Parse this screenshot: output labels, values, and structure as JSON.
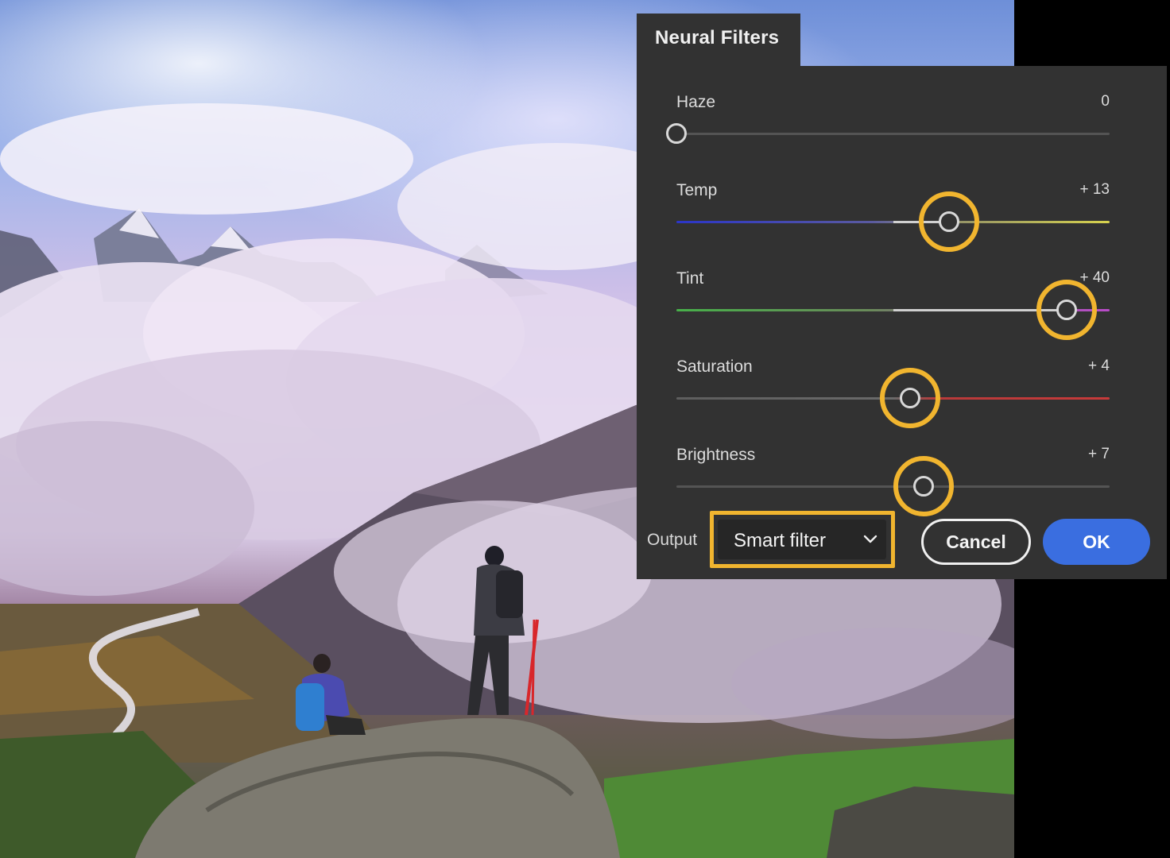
{
  "panel": {
    "title": "Neural Filters"
  },
  "sliders": [
    {
      "label": "Haze",
      "value_text": "0",
      "value": 0,
      "min": 0,
      "max": 100,
      "gradient": "neutral",
      "highlighted": false
    },
    {
      "label": "Temp",
      "value_text": "+ 13",
      "value": 13,
      "min": -50,
      "max": 50,
      "gradient": "temp",
      "highlighted": true
    },
    {
      "label": "Tint",
      "value_text": "+ 40",
      "value": 40,
      "min": -50,
      "max": 50,
      "gradient": "tint",
      "highlighted": true
    },
    {
      "label": "Saturation",
      "value_text": "+ 4",
      "value": 4,
      "min": -50,
      "max": 50,
      "gradient": "saturation",
      "highlighted": true
    },
    {
      "label": "Brightness",
      "value_text": "+ 7",
      "value": 7,
      "min": -50,
      "max": 50,
      "gradient": "neutral",
      "highlighted": true
    }
  ],
  "output": {
    "label": "Output",
    "selected": "Smart filter"
  },
  "buttons": {
    "cancel": "Cancel",
    "ok": "OK"
  },
  "colors": {
    "panel_bg": "#323232",
    "highlight": "#f1b52f",
    "ok_blue": "#3a6ee0"
  }
}
